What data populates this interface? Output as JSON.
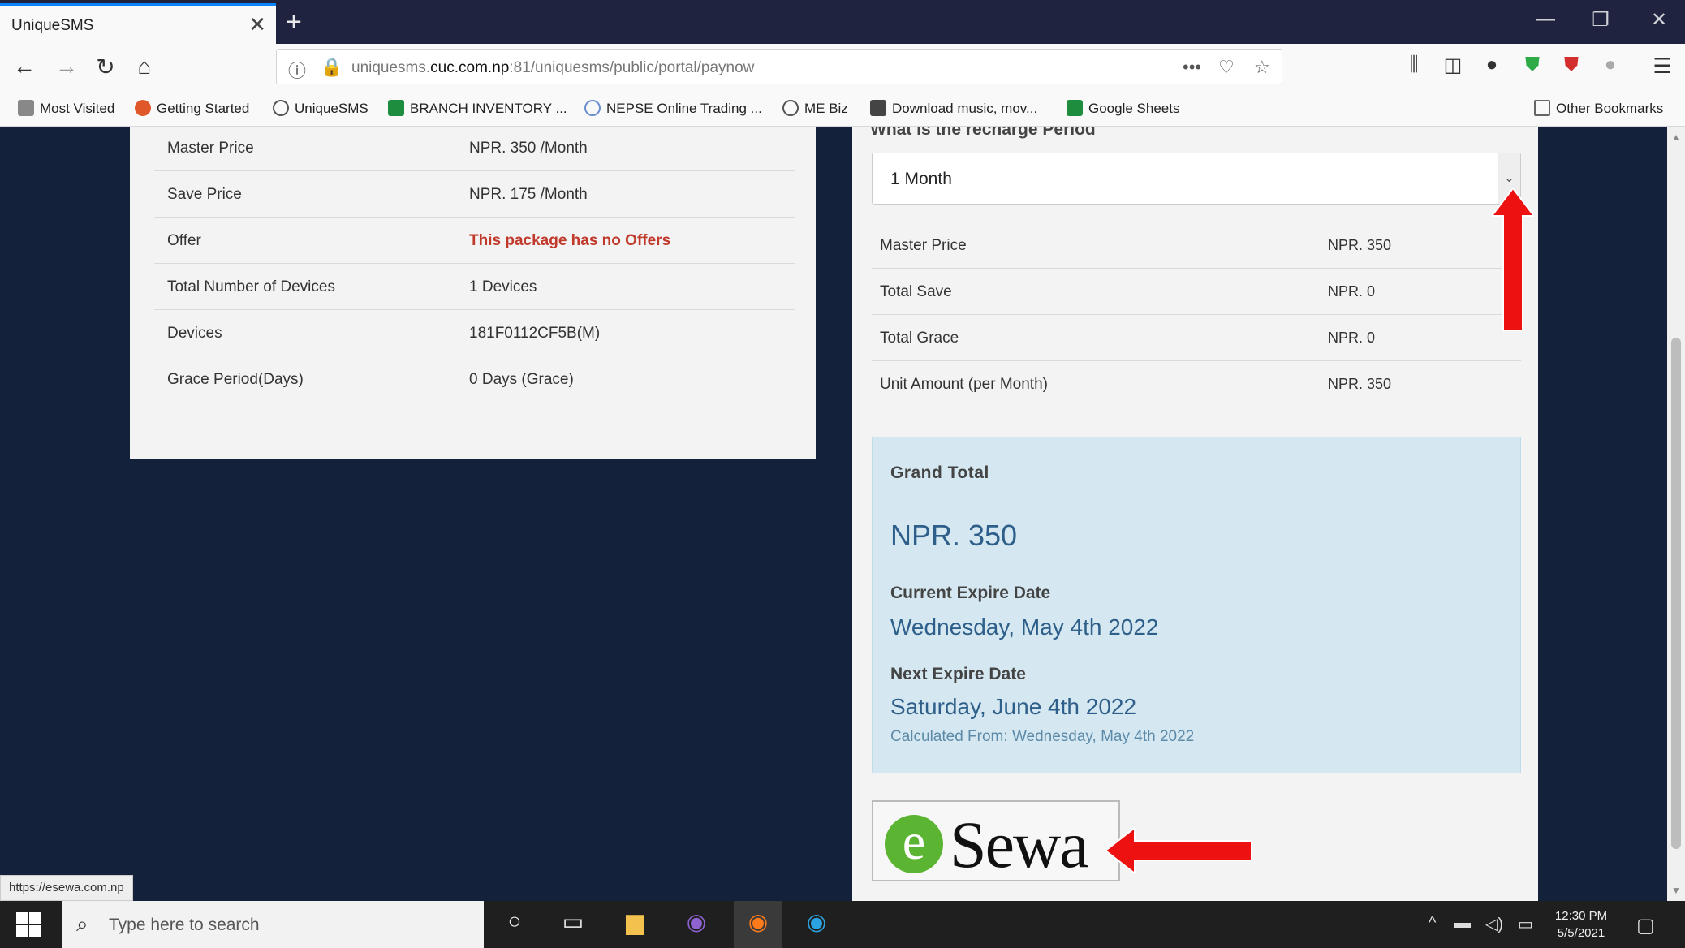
{
  "browser": {
    "tab_title": "UniqueSMS",
    "tab_close": "✕",
    "new_tab": "+",
    "url_prefix": "uniquesms.",
    "url_domain": "cuc.com.np",
    "url_path": ":81/uniquesms/public/portal/paynow",
    "window_controls": [
      "—",
      "❐",
      "✕"
    ],
    "bookmarks": [
      {
        "label": "Most Visited",
        "icon": "gear-icon",
        "color": "#555555"
      },
      {
        "label": "Getting Started",
        "icon": "firefox-icon",
        "color": "#e0572a"
      },
      {
        "label": "UniqueSMS",
        "icon": "globe-icon",
        "color": "#555555"
      },
      {
        "label": "BRANCH INVENTORY ...",
        "icon": "sheets-icon",
        "color": "#1e8e3e"
      },
      {
        "label": "NEPSE Online Trading ...",
        "icon": "globe-icon",
        "color": "#6a8fd0"
      },
      {
        "label": "ME Biz",
        "icon": "globe-icon",
        "color": "#555555"
      },
      {
        "label": "Download music, mov...",
        "icon": "download-icon",
        "color": "#444444"
      },
      {
        "label": "Google Sheets",
        "icon": "sheets-icon",
        "color": "#1e8e3e"
      }
    ],
    "other_bookmarks": "Other Bookmarks",
    "status_url": "https://esewa.com.np"
  },
  "package": {
    "rows": [
      {
        "key": "Master Price",
        "value": "NPR. 350 /Month",
        "highlight": false
      },
      {
        "key": "Save Price",
        "value": "NPR. 175 /Month",
        "highlight": false
      },
      {
        "key": "Offer",
        "value": "This package has no Offers",
        "highlight": true
      },
      {
        "key": "Total Number of Devices",
        "value": "1 Devices",
        "highlight": false
      },
      {
        "key": "Devices",
        "value": "181F0112CF5B(M)",
        "highlight": false
      },
      {
        "key": "Grace Period(Days)",
        "value": "0 Days (Grace)",
        "highlight": false
      }
    ]
  },
  "recharge": {
    "period_label": "What is the recharge Period",
    "period_value": "1 Month",
    "rows": [
      {
        "key": "Master Price",
        "value": "NPR. 350"
      },
      {
        "key": "Total Save",
        "value": "NPR. 0"
      },
      {
        "key": "Total Grace",
        "value": "NPR. 0"
      },
      {
        "key": "Unit Amount (per Month)",
        "value": "NPR. 350"
      }
    ],
    "grand_total_label": "Grand Total",
    "grand_total_value": "NPR. 350",
    "current_expire_label": "Current Expire Date",
    "current_expire_value": "Wednesday, May 4th 2022",
    "next_expire_label": "Next Expire Date",
    "next_expire_value": "Saturday, June 4th 2022",
    "calculated_from": "Calculated From: Wednesday, May 4th 2022",
    "esewa_letter": "e",
    "esewa_text": "Sewa"
  },
  "taskbar": {
    "search_placeholder": "Type here to search",
    "time": "12:30 PM",
    "date": "5/5/2021"
  },
  "colors": {
    "page_bg": "#14213a",
    "annotation_red": "#ee1111",
    "offer_red": "#c0392b",
    "total_box_bg": "#d5e8f1",
    "esewa_green": "#5bb432"
  }
}
